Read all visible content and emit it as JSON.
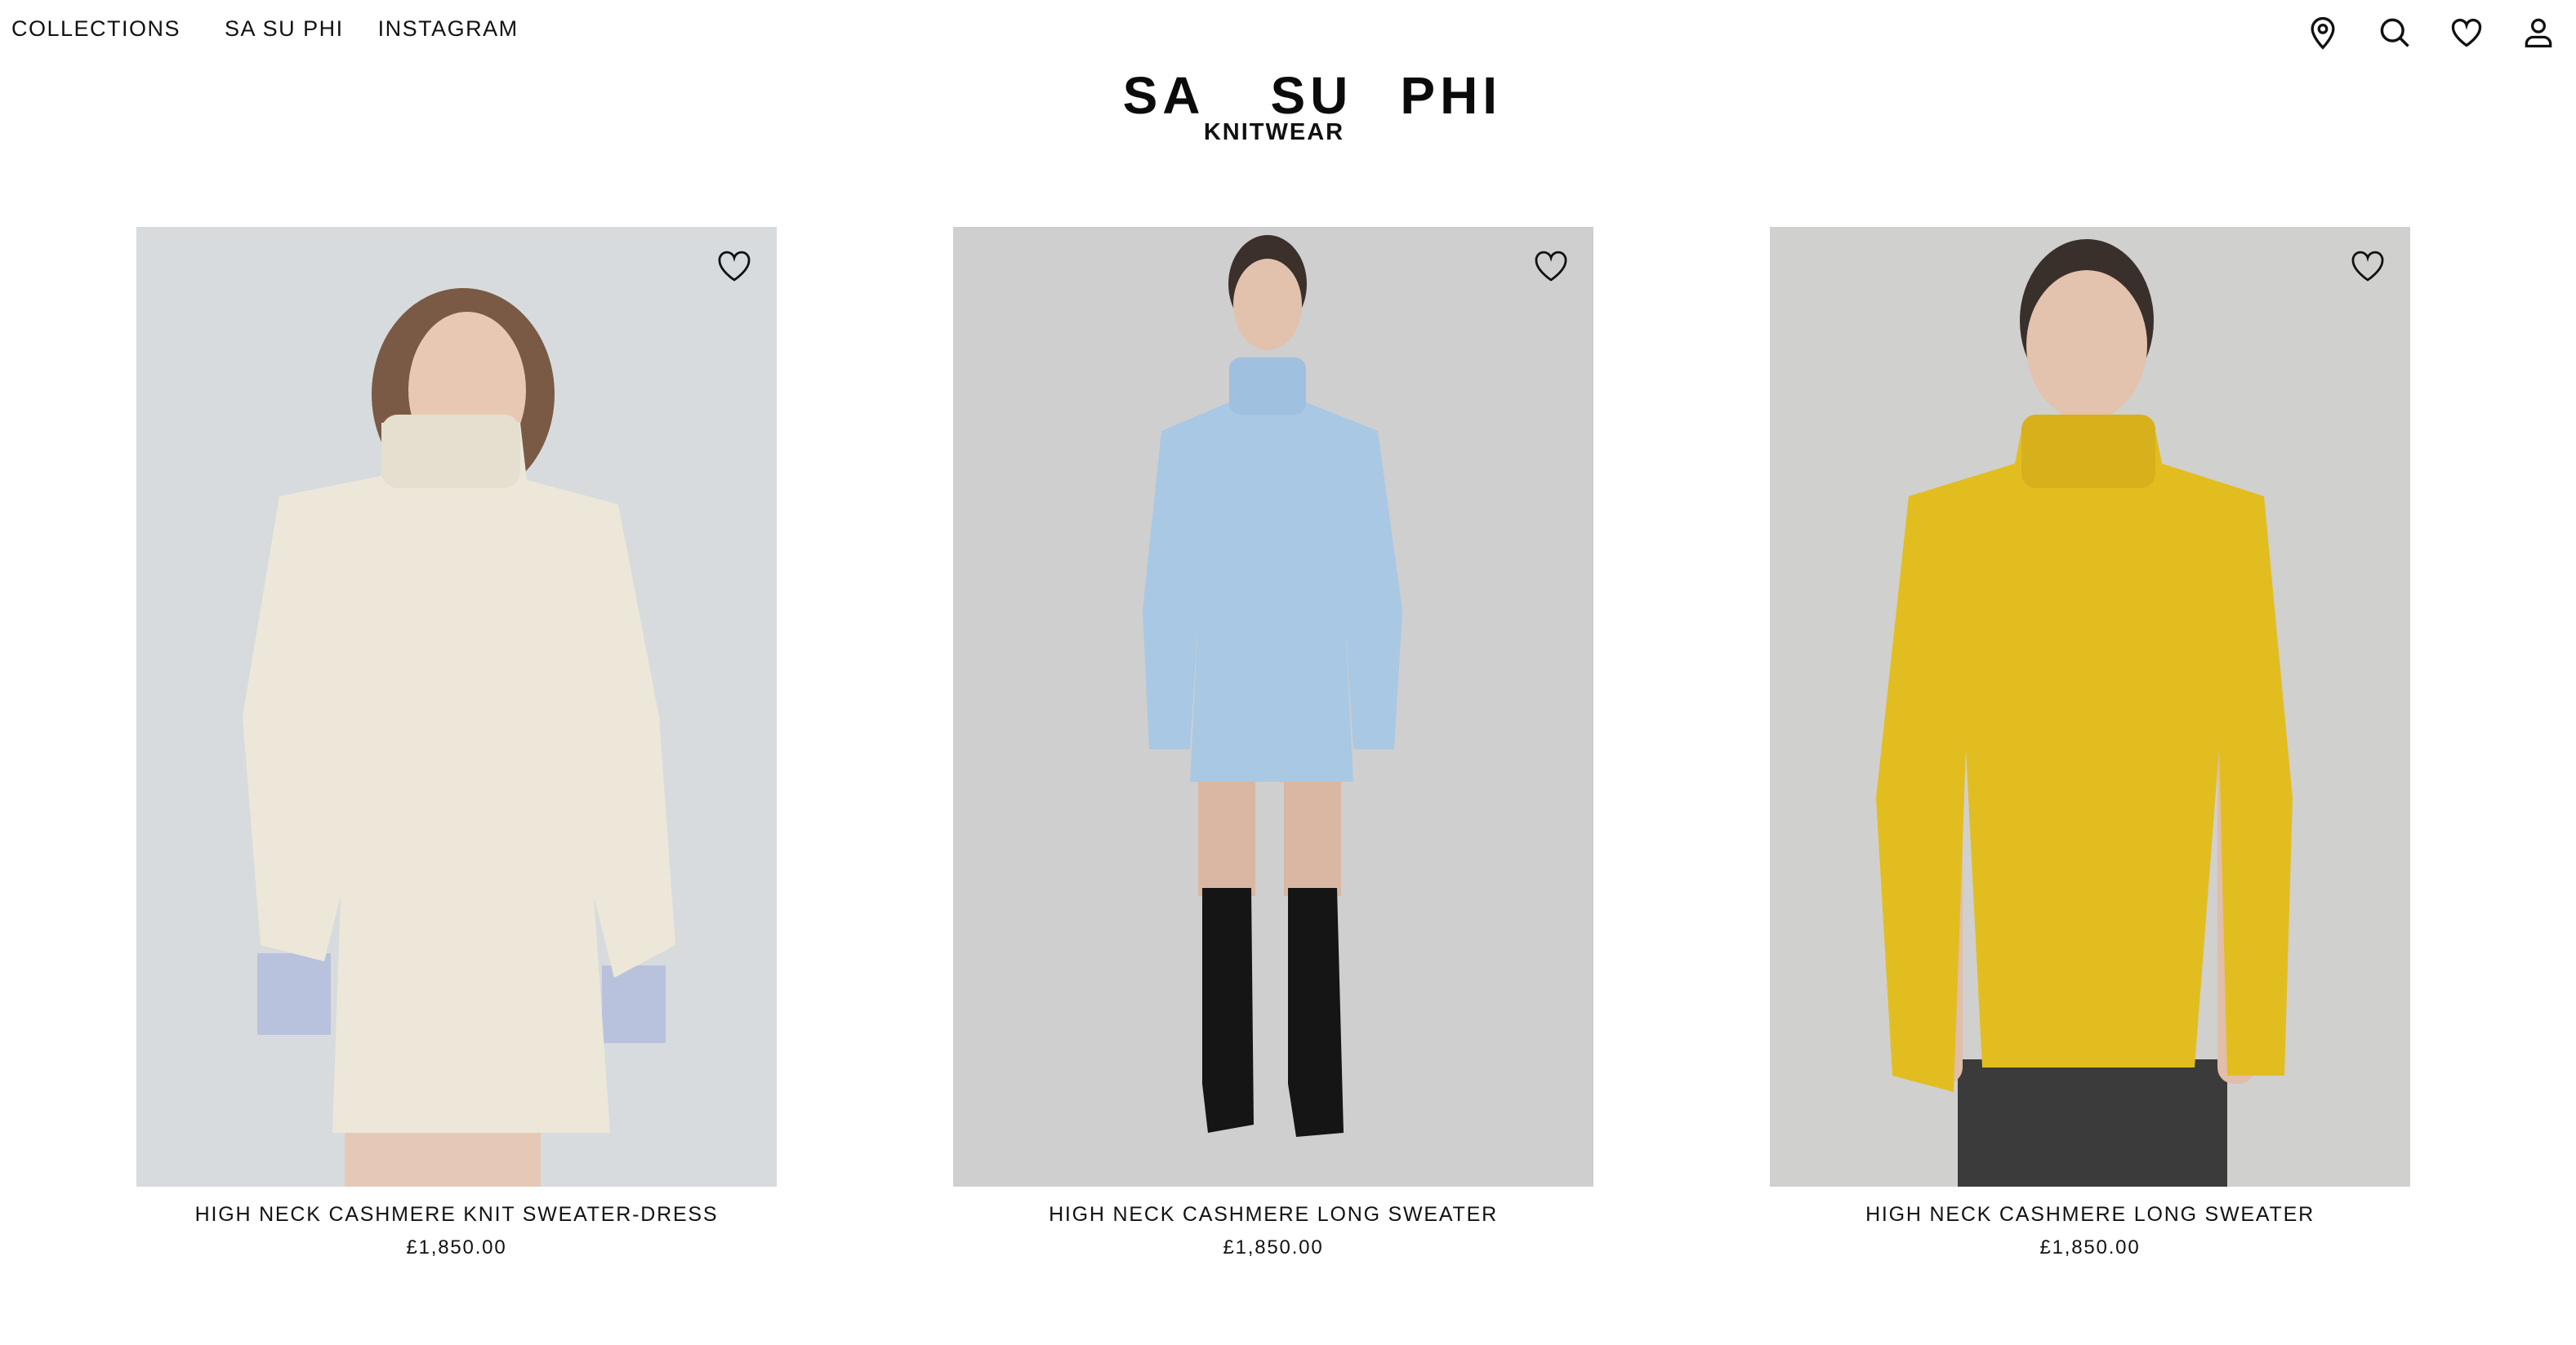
{
  "nav": {
    "links": [
      "COLLECTIONS",
      "SA SU PHI",
      "INSTAGRAM"
    ]
  },
  "brand": {
    "parts": [
      "SA",
      "SU",
      "PHI"
    ]
  },
  "header_icons": [
    "location-pin-icon",
    "search-icon",
    "heart-icon",
    "user-icon"
  ],
  "page": {
    "title": "KNITWEAR"
  },
  "products": [
    {
      "name": "HIGH NECK CASHMERE KNIT SWEATER-DRESS",
      "price": "£1,850.00",
      "sweater_color": "#ece7d8",
      "bg_color": "#d7dbde",
      "favorite_icon": "heart-outline-icon"
    },
    {
      "name": "HIGH NECK CASHMERE LONG SWEATER",
      "price": "£1,850.00",
      "sweater_color": "#a9c8e4",
      "bg_color": "#cfcfcf",
      "favorite_icon": "heart-outline-icon"
    },
    {
      "name": "HIGH NECK CASHMERE LONG SWEATER",
      "price": "£1,850.00",
      "sweater_color": "#e2bd20",
      "bg_color": "#d0d0cf",
      "favorite_icon": "heart-outline-icon"
    }
  ]
}
